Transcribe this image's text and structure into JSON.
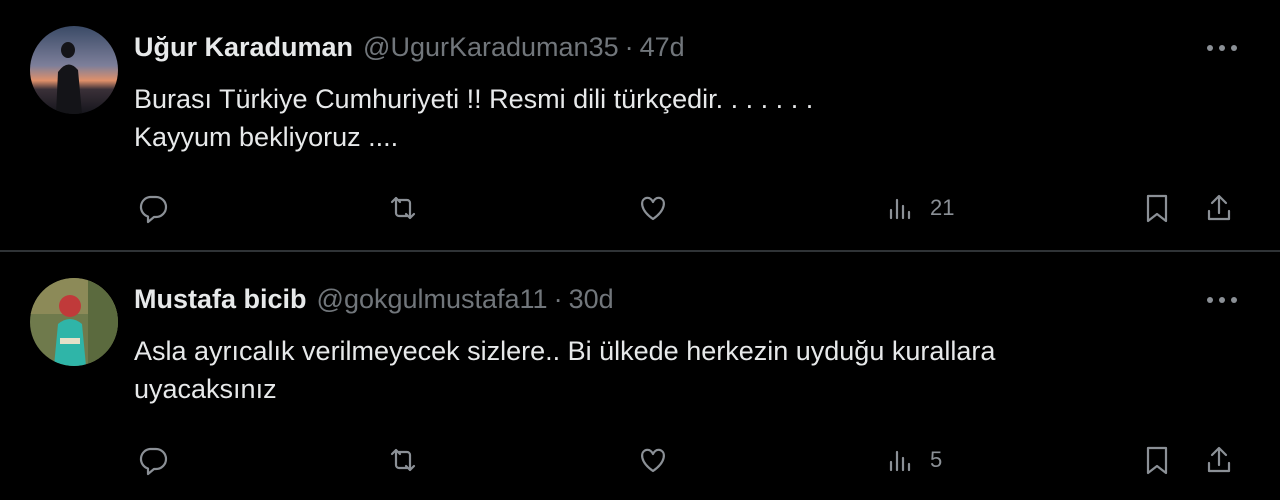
{
  "tweets": [
    {
      "name": "Uğur Karaduman",
      "handle": "@UgurKaraduman35",
      "separator": "·",
      "time": "47d",
      "lines": [
        "Burası Türkiye Cumhuriyeti !! Resmi dili türkçedir.  . . . . . .",
        "Kayyum bekliyoruz ...."
      ],
      "views": "21",
      "icons": [
        "reply-icon",
        "retweet-icon",
        "like-icon",
        "views-icon",
        "bookmark-icon",
        "share-icon",
        "more-icon"
      ]
    },
    {
      "name": "Mustafa bicib",
      "handle": "@gokgulmustafa11",
      "separator": "·",
      "time": "30d",
      "lines": [
        "Asla ayrıcalık verilmeyecek sizlere.. Bi ülkede herkezin uyduğu kurallara",
        "uyacaksınız"
      ],
      "views": "5",
      "icons": [
        "reply-icon",
        "retweet-icon",
        "like-icon",
        "views-icon",
        "bookmark-icon",
        "share-icon",
        "more-icon"
      ]
    }
  ],
  "colors": {
    "background": "#000000",
    "text": "#e7e9ea",
    "secondary": "#71767b",
    "divider": "#2f3336"
  }
}
